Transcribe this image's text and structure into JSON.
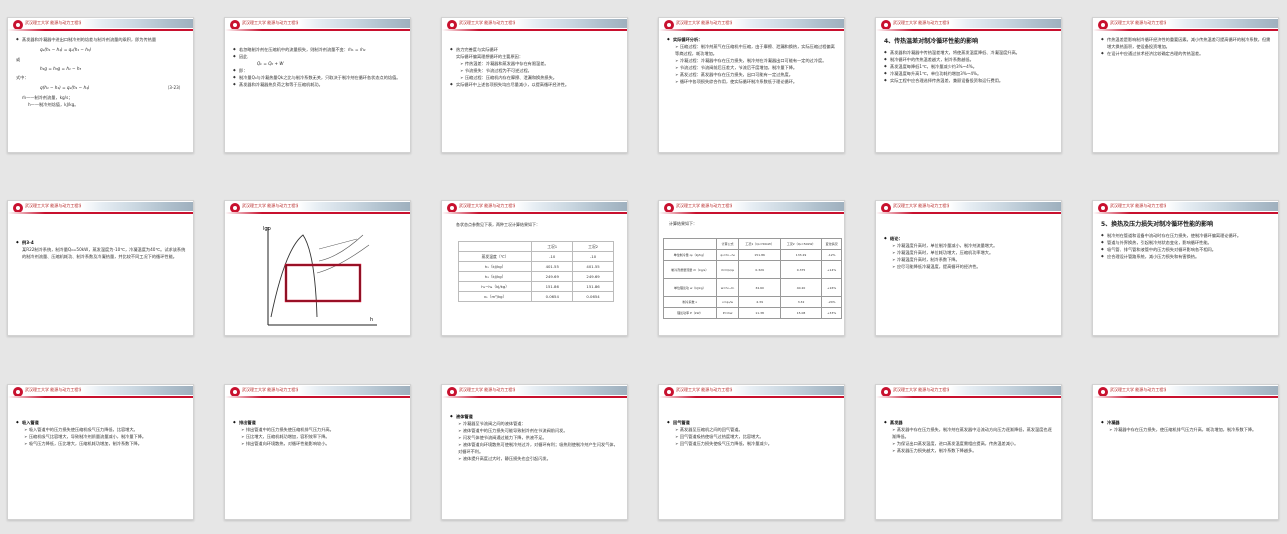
{
  "header": {
    "university": "武汉理工大学  能源与动力工程学院"
  },
  "slides": {
    "s1": {
      "lines": [
        "蒸发器和冷凝器中进出口制冷剂的焓差与制冷剂流量的乘积，即为传热量",
        "或",
        "式中：",
        "ṁ——制冷剂流量，kg/s；",
        "h——制冷剂焓值，kJ/kg。"
      ],
      "eqs": [
        "qₑ(h₁ − h₄) = qₑ(h₁ − h₃)",
        "h₁g = h₃g = h₁ − h₃",
        "q(h₁ − h₄) = qₑ(h₁ − h₄)"
      ],
      "eq_no": "（3-23）"
    },
    "s2": {
      "lines": [
        "若忽略制冷剂在压缩机中的流量损失，则制冷剂流量不变：ṁ₁ = ṁ₂",
        "因此",
        "即：",
        "制冷量Q₀与冷凝热量Qk之比与制冷系数无关，只取决于制冷剂在循环各状态点的焓值。",
        "蒸发器和冷凝器热负荷之和等于压缩机耗功。"
      ],
      "eq": "Qₖ = Q₀ + W"
    },
    "s3": {
      "lines": [
        "热力完善度与实际循环",
        "实际循环偏离理想循环的主要原因：",
        "➢ 传热温差：冷凝器和蒸发器中存在有限温差。",
        "➢ 节流损失：节流过程为不可逆过程。",
        "➢ 压缩过程：压缩机内存在摩擦、泄漏和换热损失。",
        "实际循环中上述各项损失均应尽量减小，以提高循环经济性。"
      ]
    },
    "s4": {
      "lines": [
        "实际循环分析：",
        "➢ 压缩过程：制冷剂蒸气在压缩机中压缩，由于摩擦、泄漏和换热，实际压缩过程偏离等熵过程，耗功增加。",
        "➢ 冷凝过程：冷凝器中存在压力损失，制冷剂在冷凝器出口可能有一定的过冷度。",
        "➢ 节流过程：节流阀前后压差大，节流后干度增加，制冷量下降。",
        "➢ 蒸发过程：蒸发器中存在压力损失，出口可能有一定过热度。",
        "➢ 循环中各项损失综合作用，使实际循环制冷系数低于理论循环。"
      ]
    },
    "s5": {
      "title": "4、传热温差对制冷循环性能的影响",
      "lines": [
        "蒸发器和冷凝器中传热温差增大，将使蒸发温度降低、冷凝温度升高。",
        "制冷循环中的传热温差越大，制冷系数越低。",
        "蒸发温度每降低1℃，制冷量减少约3%~4%。",
        "冷凝温度每升高1℃，单位功耗约增加3%~4%。",
        "实际工程中应合理选择传热温差，兼顾设备投资和运行费用。"
      ]
    },
    "s6": {
      "lines": [
        "传热温差是影响制冷循环经济性的重要因素。减小传热温差可提高循环的制冷系数，但需增大换热面积，使设备投资增加。",
        "在设计中应通过技术经济比较确定合理的传热温差。"
      ]
    },
    "s7": {
      "label": "例3-4",
      "text": "某R22制冷系统，制冷量Q₀=50kW，蒸发温度为-10℃，冷凝温度为40℃。试求该系统的制冷剂流量、压缩机耗功、制冷系数及冷凝热量，并比较不同工况下的循环性能。"
    },
    "s8": {
      "axis_y": "lgp",
      "axis_x": "h"
    },
    "s9": {
      "caption": "各状态点参数见下表，两种工况计算结果如下：",
      "col1": "工况1",
      "col2": "工况2",
      "rows": [
        [
          "蒸发温度（℃）",
          "-10",
          "-10"
        ],
        [
          "h₁（kJ/kg）",
          "401.55",
          "401.55"
        ],
        [
          "h₃（kJ/kg）",
          "249.69",
          "249.69"
        ],
        [
          "h₁−h₄（kJ/kg）",
          "151.86",
          "151.86"
        ],
        [
          "v₁（m³/kg）",
          "0.0654",
          "0.0654"
        ]
      ]
    },
    "s10": {
      "caption": "计算结果如下：",
      "cols": [
        "",
        "计算公式",
        "工况1（Q₀=50kW）",
        "工况2（Q₀=50kW）",
        "变化情况"
      ],
      "rows": [
        [
          "单位制冷量 q₀（kJ/kg）",
          "q₀=h₁−h₄",
          "151.86",
          "133.29",
          "-12%"
        ],
        [
          "制冷剂质量流量 ṁ（kg/s）",
          "ṁ=Q₀/q₀",
          "0.329",
          "0.375",
          "+14%"
        ],
        [
          "单位理论功 w（kJ/kg）",
          "w=h₂−h₁",
          "34.60",
          "40.20",
          "+16%"
        ],
        [
          "制冷系数 ε",
          "ε=q₀/w",
          "4.39",
          "3.32",
          "-24%"
        ],
        [
          "理论功率 P（kW）",
          "P=ṁw",
          "11.38",
          "15.08",
          "+33%"
        ]
      ]
    },
    "s11": {
      "lines": [
        "结论：",
        "➢ 冷凝温度升高时，单位制冷量减小，制冷剂流量增大。",
        "➢ 冷凝温度升高时，单位耗功增大，压缩机功率增大。",
        "➢ 冷凝温度升高时，制冷系数下降。",
        "➢ 应尽可能降低冷凝温度，提高循环的经济性。"
      ]
    },
    "s12": {
      "title": "5、换热及压力损失对制冷循环性能的影响",
      "lines": [
        "制冷剂在管道和设备中流动时存在压力损失，使制冷循环偏离理论循环。",
        "管道与外界换热，引起制冷剂状态变化，影响循环性能。",
        "吸气管、排气管和液管中的压力损失对循环影响各不相同。",
        "应合理设计管路系统，减小压力损失和有害换热。"
      ]
    },
    "s13": {
      "label": "吸入管道",
      "lines": [
        "➢ 吸入管道中的压力损失使压缩机吸气压力降低，比容增大。",
        "➢ 压缩机吸气比容增大，导致制冷剂质量流量减小，制冷量下降。",
        "➢ 吸气压力降低，压比增大，压缩机耗功增加，制冷系数下降。"
      ]
    },
    "s14": {
      "label": "排出管道",
      "lines": [
        "➢ 排出管道中的压力损失使压缩机排气压力升高。",
        "➢ 压比增大，压缩机耗功增加，容积效率下降。",
        "➢ 排出管道向环境散热，对循环性能影响较小。"
      ]
    },
    "s15": {
      "label": "液体管道",
      "lines": [
        "➢ 冷凝器至节流阀之间的液体管道：",
        "➢ 液体管道中的压力损失可能导致制冷剂在节流阀前闪发。",
        "➢ 闪发气体使节流阀通过能力下降，供液不足。",
        "➢ 液体管道向环境散热可使制冷剂过冷，对循环有利；吸热则使制冷剂产生闪发气体，对循环不利。",
        "➢ 液体提升高度过大时，静压损失也会引起闪发。"
      ]
    },
    "s16": {
      "label": "回气管道",
      "lines": [
        "➢ 蒸发器至压缩机之间的回气管道。",
        "➢ 回气管道吸热使吸气过热度增大，比容增大。",
        "➢ 回气管道压力损失使吸气压力降低，制冷量减少。"
      ]
    },
    "s17": {
      "label": "蒸发器",
      "lines": [
        "➢ 蒸发器中存在压力损失，制冷剂在蒸发器中沿流动方向压力逐渐降低，蒸发温度也逐渐降低。",
        "➢ 为保证出口蒸发温度，进口蒸发温度需相应提高，传热温差减小。",
        "➢ 蒸发器压力损失越大，制冷系数下降越多。"
      ]
    },
    "s18": {
      "label": "冷凝器",
      "lines": [
        "➢ 冷凝器中存在压力损失，使压缩机排气压力升高，耗功增加，制冷系数下降。"
      ]
    }
  }
}
